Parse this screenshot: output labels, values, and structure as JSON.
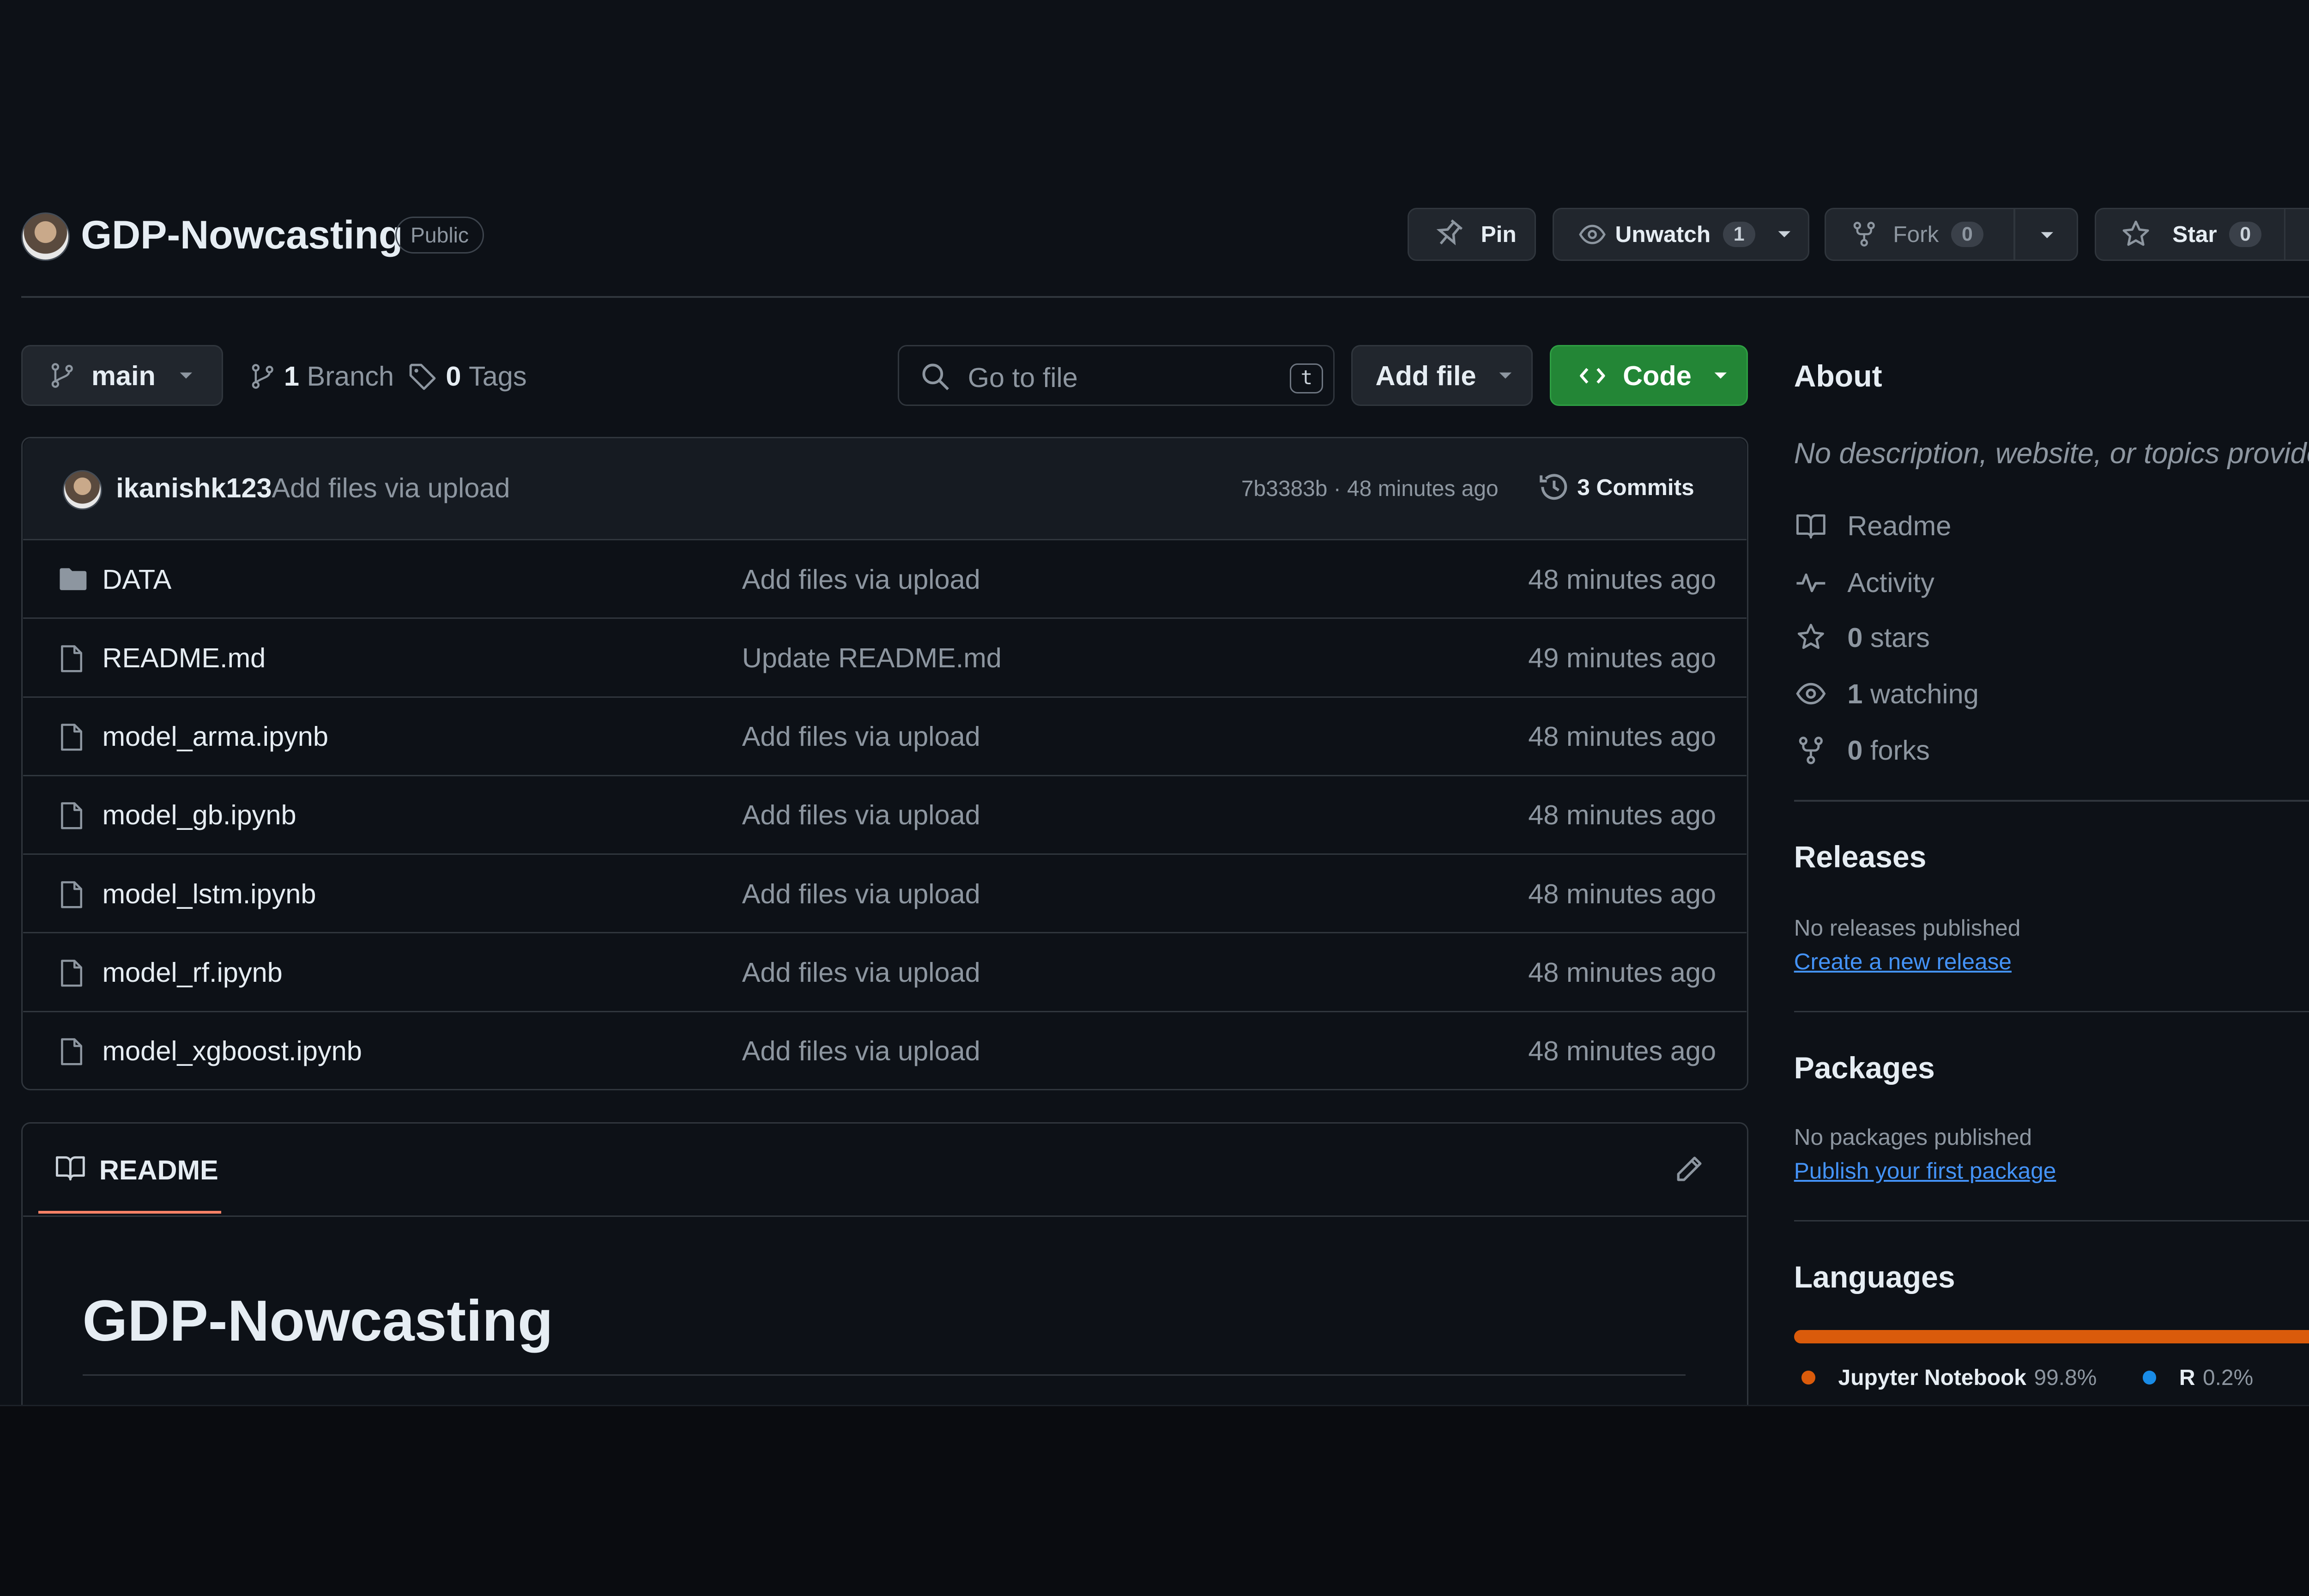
{
  "repo": {
    "name": "GDP-Nowcasting",
    "visibility": "Public"
  },
  "actions": {
    "pin_label": "Pin",
    "unwatch_label": "Unwatch",
    "unwatch_count": "1",
    "fork_label": "Fork",
    "fork_count": "0",
    "star_label": "Star",
    "star_count": "0"
  },
  "toolbar": {
    "branch": "main",
    "branches_count": "1",
    "branches_label": "Branch",
    "tags_count": "0",
    "tags_label": "Tags",
    "goto_placeholder": "Go to file",
    "goto_shortcut": "t",
    "add_file_label": "Add file",
    "code_label": "Code"
  },
  "commit": {
    "author": "ikanishk123",
    "message": "Add files via upload",
    "sha_time": "7b3383b · 48 minutes ago",
    "commits_label": "3 Commits"
  },
  "files": [
    {
      "name": "DATA",
      "type": "folder",
      "message": "Add files via upload",
      "time": "48 minutes ago"
    },
    {
      "name": "README.md",
      "type": "file",
      "message": "Update README.md",
      "time": "49 minutes ago"
    },
    {
      "name": "model_arma.ipynb",
      "type": "file",
      "message": "Add files via upload",
      "time": "48 minutes ago"
    },
    {
      "name": "model_gb.ipynb",
      "type": "file",
      "message": "Add files via upload",
      "time": "48 minutes ago"
    },
    {
      "name": "model_lstm.ipynb",
      "type": "file",
      "message": "Add files via upload",
      "time": "48 minutes ago"
    },
    {
      "name": "model_rf.ipynb",
      "type": "file",
      "message": "Add files via upload",
      "time": "48 minutes ago"
    },
    {
      "name": "model_xgboost.ipynb",
      "type": "file",
      "message": "Add files via upload",
      "time": "48 minutes ago"
    }
  ],
  "readme": {
    "tab_label": "README",
    "heading": "GDP-Nowcasting"
  },
  "about": {
    "title": "About",
    "description": "No description, website, or topics provided.",
    "items": [
      {
        "icon": "book-icon",
        "count": "",
        "label": "Readme"
      },
      {
        "icon": "pulse-icon",
        "count": "",
        "label": "Activity"
      },
      {
        "icon": "star-icon",
        "count": "0",
        "label": "stars"
      },
      {
        "icon": "eye-icon",
        "count": "1",
        "label": "watching"
      },
      {
        "icon": "fork-icon",
        "count": "0",
        "label": "forks"
      }
    ]
  },
  "releases": {
    "title": "Releases",
    "empty": "No releases published",
    "link": "Create a new release"
  },
  "packages": {
    "title": "Packages",
    "empty": "No packages published",
    "link": "Publish your first package"
  },
  "languages": {
    "title": "Languages",
    "items": [
      {
        "name": "Jupyter Notebook",
        "percent": "99.8%",
        "value": 99.8,
        "color": "#da5b0b"
      },
      {
        "name": "R",
        "percent": "0.2%",
        "value": 0.2,
        "color": "#198ce7"
      }
    ]
  },
  "colors": {
    "background": "#0d1117",
    "accent_green": "#238636",
    "link": "#4493f8",
    "tab_underline": "#f78166"
  }
}
